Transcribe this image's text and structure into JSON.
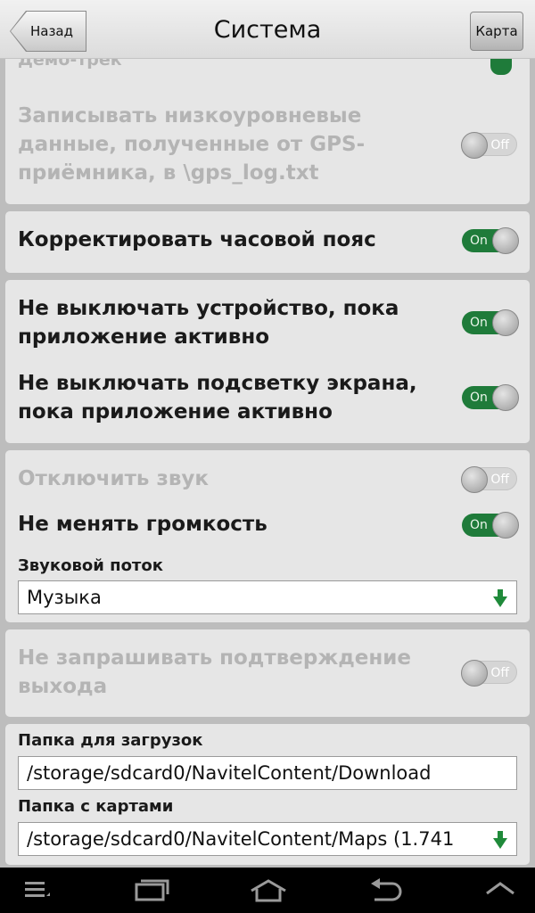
{
  "header": {
    "back_label": "Назад",
    "title": "Система",
    "map_label": "Карта"
  },
  "groups": {
    "gps": {
      "demo_partial": "Демо-трек",
      "gps_log_label_lines": [
        "Записывать низкоуровневые",
        "данные, полученные от GPS-",
        "приёмника, в \\gps_log.txt"
      ],
      "gps_log_state": "Off"
    },
    "timezone": {
      "label": "Корректировать часовой пояс",
      "state": "On"
    },
    "power": {
      "keep_device_lines": [
        "Не выключать устройство, пока",
        "приложение активно"
      ],
      "keep_device_state": "On",
      "keep_backlight_lines": [
        "Не выключать подсветку экрана,",
        "пока приложение активно"
      ],
      "keep_backlight_state": "On"
    },
    "sound": {
      "mute_label": "Отключить звук",
      "mute_state": "Off",
      "keep_volume_label": "Не менять громкость",
      "keep_volume_state": "On",
      "stream_label": "Звуковой поток",
      "stream_value": "Музыка"
    },
    "exit": {
      "label_lines": [
        "Не запрашивать подтверждение",
        "выхода"
      ],
      "state": "Off"
    },
    "folders": {
      "download_label": "Папка для загрузок",
      "download_value": "/storage/sdcard0/NavitelContent/Download",
      "maps_label": "Папка с картами",
      "maps_value": "/storage/sdcard0/NavitelContent/Maps (1.741"
    }
  },
  "colors": {
    "toggle_on": "#1f7b3a",
    "panel": "#e6e6e6",
    "background": "#bdbdbd"
  },
  "icons": {
    "nav": [
      "menu-icon",
      "recent-apps-icon",
      "home-icon",
      "back-icon",
      "chevron-up-icon"
    ]
  }
}
